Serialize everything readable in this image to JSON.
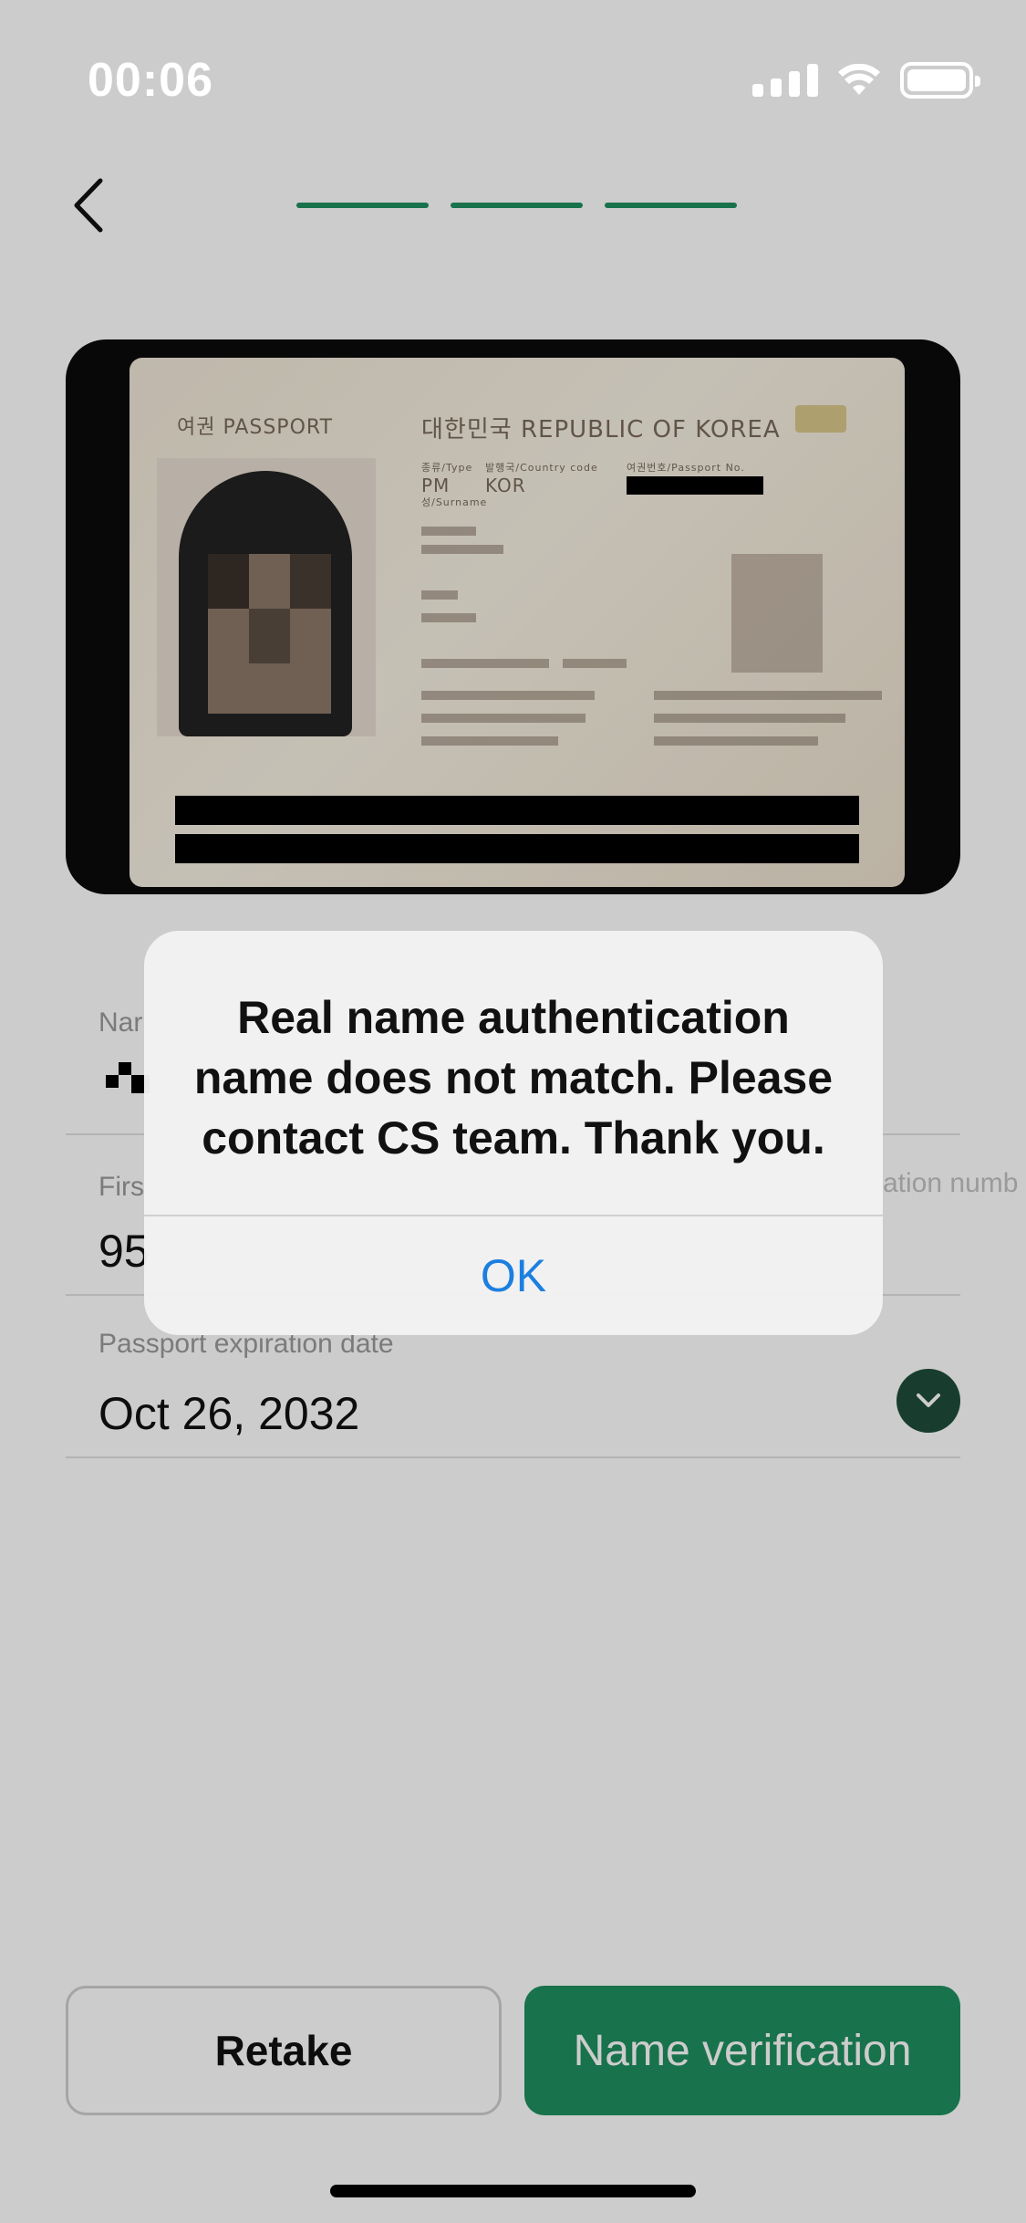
{
  "status_bar": {
    "time": "00:06",
    "icons": [
      "signal-icon",
      "wifi-icon",
      "battery-icon"
    ]
  },
  "header": {
    "back_icon": "chevron-left-icon",
    "progress_steps": 3,
    "progress_completed": 3,
    "accent_color": "#1e8f5f"
  },
  "passport_image": {
    "type_label": "여권 PASSPORT",
    "country_label": "대한민국 REPUBLIC OF KOREA",
    "type_small": "종류/Type",
    "country_code_small": "발행국/Country code",
    "passport_no_small": "여권번호/Passport No.",
    "surname_small": "성/Surname",
    "type_value": "PM",
    "country_code_value": "KOR"
  },
  "form": {
    "fields": [
      {
        "label": "Nar",
        "value": ""
      },
      {
        "label": "Firs",
        "value": "95",
        "extra_label": "ation numb"
      },
      {
        "label": "Passport expiration date",
        "value": "Oct 26, 2032",
        "icon": "chevron-down-icon"
      }
    ]
  },
  "buttons": {
    "retake": "Retake",
    "verify": "Name verification"
  },
  "alert": {
    "message": "Real name authentication name does not match. Please contact CS team. Thank you.",
    "ok": "OK"
  }
}
